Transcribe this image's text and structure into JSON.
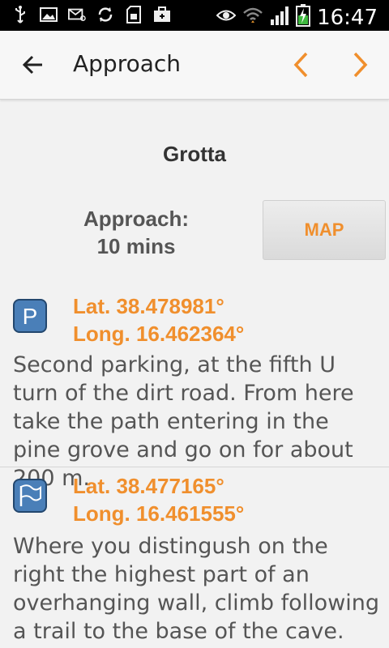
{
  "status_bar": {
    "time": "16:47",
    "left_icons": [
      "usb-icon",
      "image-icon",
      "mail-icon",
      "sync-icon",
      "sd-card-icon",
      "briefcase-icon"
    ],
    "right_icons": [
      "eye-icon",
      "wifi-icon",
      "signal-icon",
      "battery-charging-icon"
    ]
  },
  "app_bar": {
    "title": "Approach",
    "accent_color": "#f08f2d"
  },
  "sector": {
    "name": "Grotta",
    "approach_label": "Approach:",
    "approach_time": "10 mins",
    "map_button_label": "MAP"
  },
  "points": [
    {
      "icon": "parking-icon",
      "lat": "Lat. 38.478981°",
      "long": "Long. 16.462364°",
      "description": "Second parking, at the fifth U turn of the dirt road. From here take the path entering in the pine grove and go on for about 200 m."
    },
    {
      "icon": "flag-icon",
      "lat": "Lat. 38.477165°",
      "long": "Long. 16.461555°",
      "description": "Where you distingush on the right the highest part of an overhanging wall, climb following a trail to the base of the cave."
    }
  ]
}
